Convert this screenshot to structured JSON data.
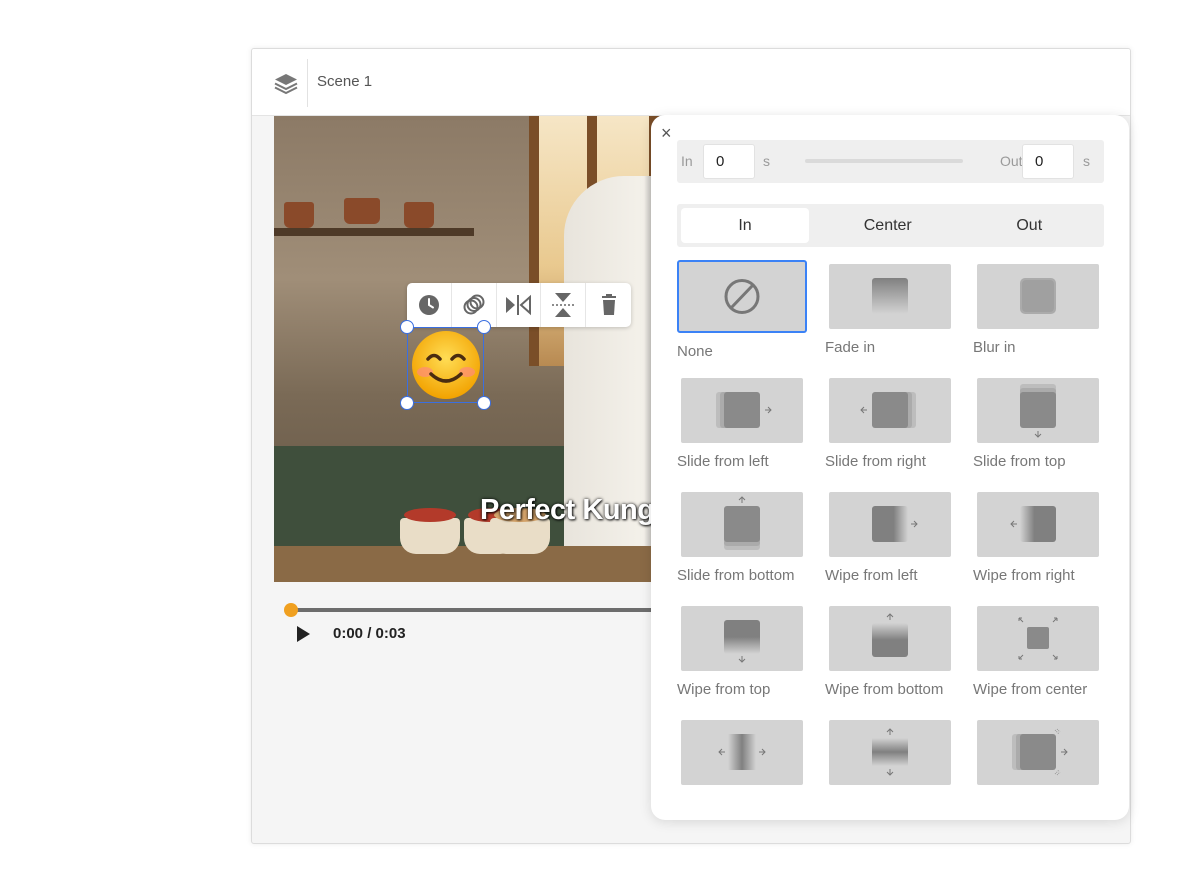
{
  "header": {
    "scene_title": "Scene 1"
  },
  "video": {
    "caption": "Perfect Kung"
  },
  "playback": {
    "time": "0:00 / 0:03"
  },
  "panel": {
    "close_label": "×",
    "timing": {
      "in_label": "In",
      "in_value": "0",
      "in_unit": "s",
      "out_label": "Out",
      "out_value": "0",
      "out_unit": "s"
    },
    "tabs": [
      "In",
      "Center",
      "Out"
    ],
    "effects": [
      "None",
      "Fade in",
      "Blur in",
      "Slide from left",
      "Slide from right",
      "Slide from top",
      "Slide from bottom",
      "Wipe from left",
      "Wipe from right",
      "Wipe from top",
      "Wipe from bottom",
      "Wipe from center",
      "",
      "",
      ""
    ]
  },
  "colors": {
    "accent": "#3b82f6",
    "selection": "#3b6fe0",
    "progress": "#f0a020"
  }
}
